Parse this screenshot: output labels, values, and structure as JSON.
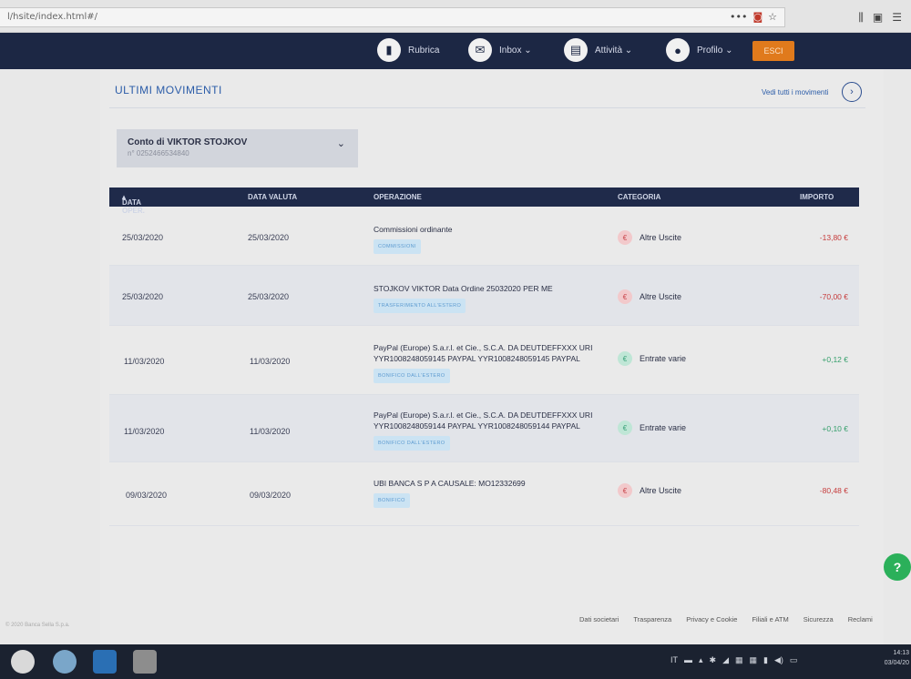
{
  "browser": {
    "url": "l/hsite/index.html#/",
    "right_icons": [
      "library-icon",
      "sidebar-icon",
      "menu-icon"
    ]
  },
  "nav": {
    "items": [
      {
        "label": "Rubrica",
        "icon": "address-book-icon"
      },
      {
        "label": "Inbox ⌄",
        "icon": "mail-icon"
      },
      {
        "label": "Attività ⌄",
        "icon": "clipboard-icon"
      },
      {
        "label": "Profilo ⌄",
        "icon": "user-icon"
      }
    ],
    "exit_label": "ESCI"
  },
  "page": {
    "title": "ULTIMI MOVIMENTI",
    "see_all": "Vedi tutti i movimenti"
  },
  "account": {
    "name": "Conto di VIKTOR STOJKOV",
    "number": "n° 0252466534840"
  },
  "table": {
    "headers": {
      "data_oper": "DATA OPER.",
      "data_valuta": "DATA VALUTA",
      "operazione": "OPERAZIONE",
      "categoria": "CATEGORIA",
      "importo": "IMPORTO"
    },
    "rows": [
      {
        "data_oper": "25/03/2020",
        "data_valuta": "25/03/2020",
        "line1": "Commissioni ordinante",
        "line2": "",
        "tag": "COMMISSIONI",
        "categoria": "Altre Uscite",
        "cat_type": "out",
        "importo": "-13,80 €",
        "sign": "neg"
      },
      {
        "data_oper": "25/03/2020",
        "data_valuta": "25/03/2020",
        "line1": "STOJKOV VIKTOR Data Ordine 25032020 PER ME",
        "line2": "",
        "tag": "TRASFERIMENTO ALL'ESTERO",
        "categoria": "Altre Uscite",
        "cat_type": "out",
        "importo": "-70,00 €",
        "sign": "neg"
      },
      {
        "data_oper": "11/03/2020",
        "data_valuta": "11/03/2020",
        "line1": "PayPal (Europe) S.a.r.l. et Cie., S.C.A. DA DEUTDEFFXXX URI",
        "line2": "YYR1008248059145 PAYPAL YYR1008248059145 PAYPAL",
        "tag": "BONIFICO DALL'ESTERO",
        "categoria": "Entrate varie",
        "cat_type": "in",
        "importo": "+0,12 €",
        "sign": "pos"
      },
      {
        "data_oper": "11/03/2020",
        "data_valuta": "11/03/2020",
        "line1": "PayPal (Europe) S.a.r.l. et Cie., S.C.A. DA DEUTDEFFXXX URI",
        "line2": "YYR1008248059144 PAYPAL YYR1008248059144 PAYPAL",
        "tag": "BONIFICO DALL'ESTERO",
        "categoria": "Entrate varie",
        "cat_type": "in",
        "importo": "+0,10 €",
        "sign": "pos"
      },
      {
        "data_oper": "09/03/2020",
        "data_valuta": "09/03/2020",
        "line1": "UBI BANCA S P A CAUSALE: MO12332699",
        "line2": "",
        "tag": "BONIFICO",
        "categoria": "Altre Uscite",
        "cat_type": "out",
        "importo": "-80,48 €",
        "sign": "neg"
      }
    ]
  },
  "footer": {
    "links": [
      "Dati societari",
      "Trasparenza",
      "Privacy e Cookie",
      "Filiali e ATM",
      "Sicurezza",
      "Reclami"
    ],
    "copyright": "© 2020 Banca Sella S.p.a."
  },
  "taskbar": {
    "lang": "IT",
    "time": "14:13",
    "date": "03/04/20"
  },
  "colors": {
    "nav_bg": "#1c2744",
    "accent": "#2b5ca8",
    "exit": "#e07a1c",
    "negative": "#c63b3b",
    "positive": "#36a06c"
  }
}
